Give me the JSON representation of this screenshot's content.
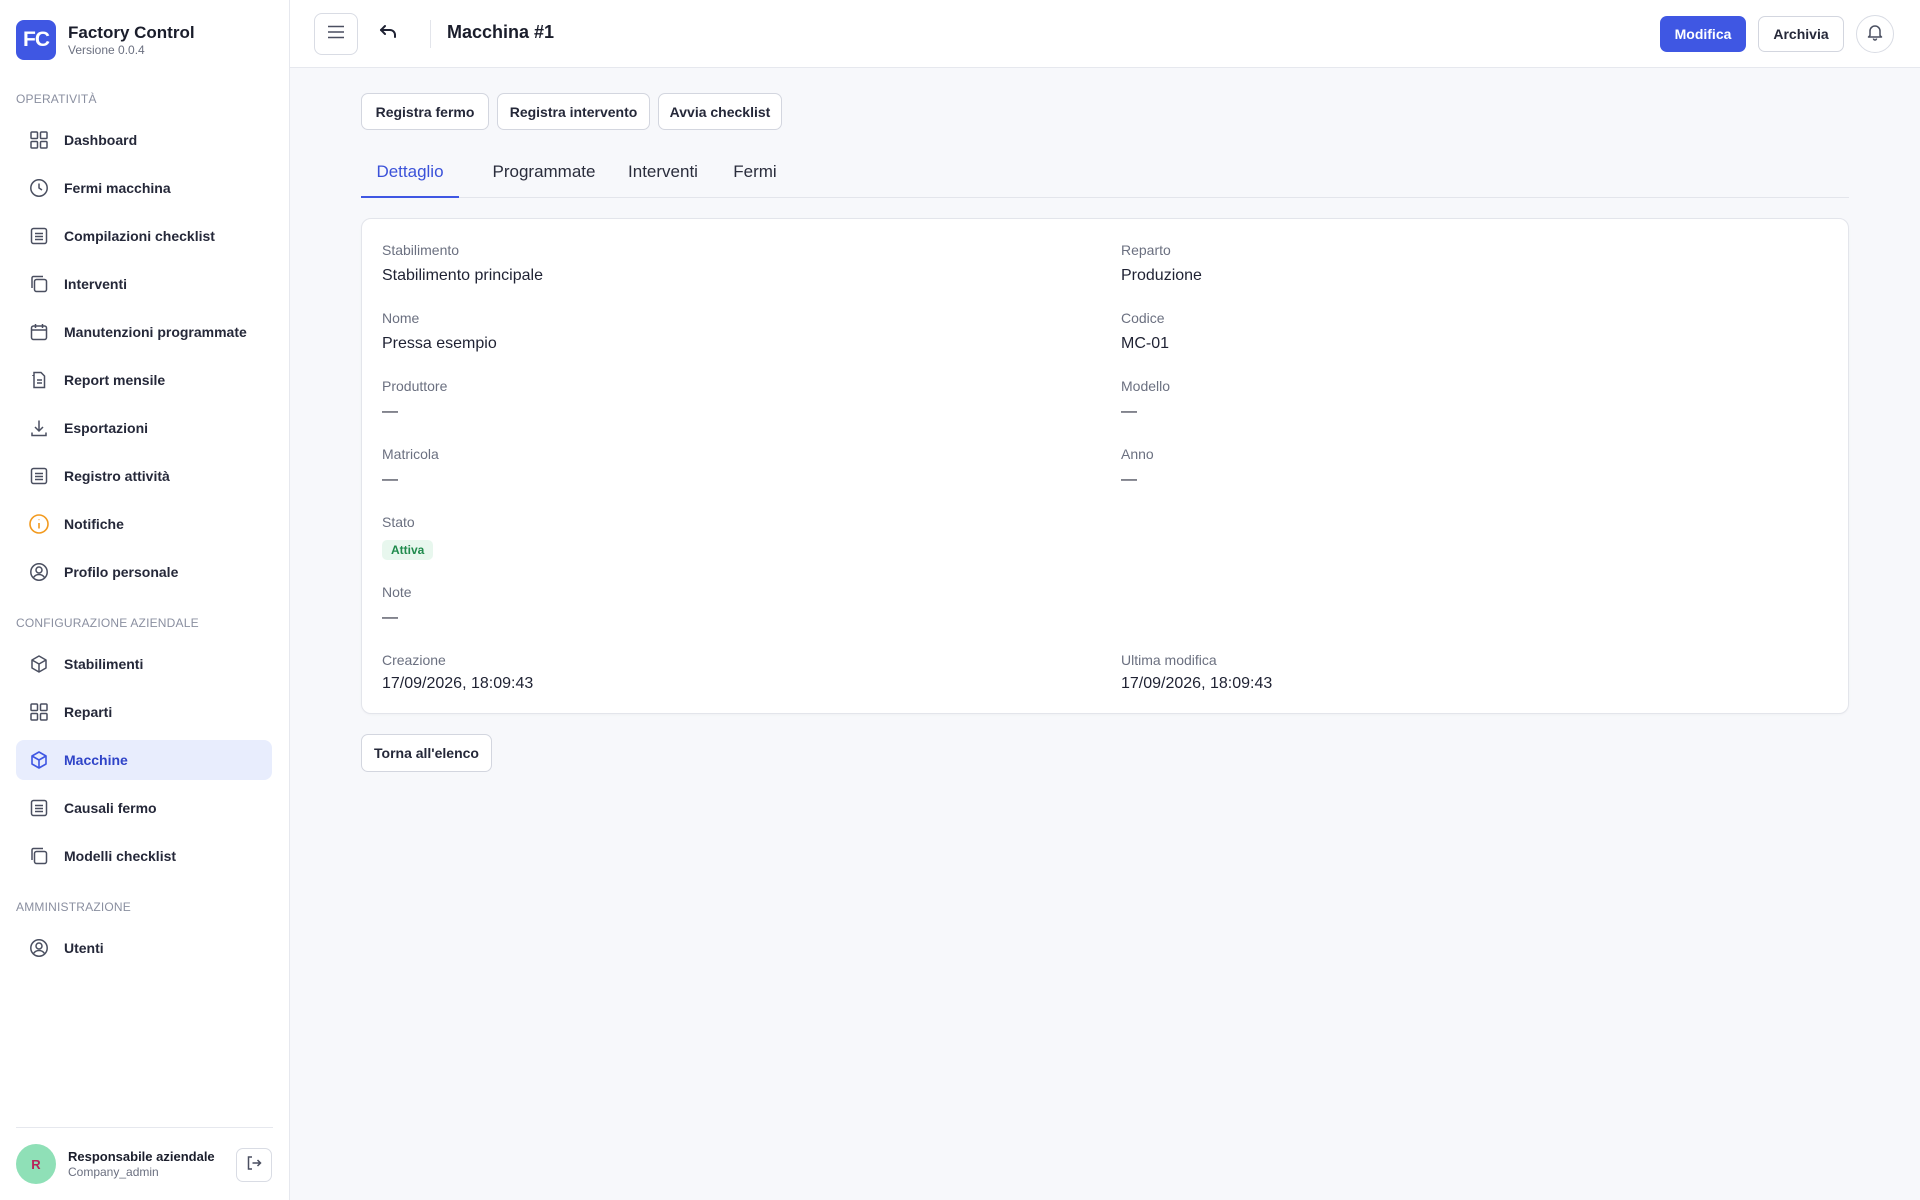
{
  "app": {
    "logo_text": "FC",
    "name": "Factory Control",
    "version": "Versione 0.0.4"
  },
  "colors": {
    "accent": "#3f57e3",
    "active_bg": "#e8edfd",
    "success": "#1f8a4c",
    "warning": "#f29a1f"
  },
  "sidebar": {
    "sections": [
      {
        "label": "OPERATIVITÀ"
      },
      {
        "label": "CONFIGURAZIONE AZIENDALE"
      },
      {
        "label": "AMMINISTRAZIONE"
      }
    ],
    "items": [
      {
        "label": "Dashboard",
        "icon": "grid-icon"
      },
      {
        "label": "Fermi macchina",
        "icon": "clock-icon"
      },
      {
        "label": "Compilazioni checklist",
        "icon": "list-icon"
      },
      {
        "label": "Interventi",
        "icon": "copy-icon"
      },
      {
        "label": "Manutenzioni programmate",
        "icon": "calendar-icon"
      },
      {
        "label": "Report mensile",
        "icon": "document-icon"
      },
      {
        "label": "Esportazioni",
        "icon": "download-icon"
      },
      {
        "label": "Registro attività",
        "icon": "list-icon"
      },
      {
        "label": "Notifiche",
        "icon": "info-icon"
      },
      {
        "label": "Profilo personale",
        "icon": "user-circle-icon"
      },
      {
        "label": "Stabilimenti",
        "icon": "cube-icon"
      },
      {
        "label": "Reparti",
        "icon": "grid-icon"
      },
      {
        "label": "Macchine",
        "icon": "cube-icon",
        "active": true
      },
      {
        "label": "Causali fermo",
        "icon": "list-icon"
      },
      {
        "label": "Modelli checklist",
        "icon": "copy-icon"
      },
      {
        "label": "Utenti",
        "icon": "user-circle-icon"
      }
    ]
  },
  "user": {
    "initial": "R",
    "name": "Responsabile aziendale",
    "role": "Company_admin"
  },
  "header": {
    "title": "Macchina #1",
    "edit_label": "Modifica",
    "archive_label": "Archivia"
  },
  "actions": [
    "Registra fermo",
    "Registra intervento",
    "Avvia checklist"
  ],
  "tabs": [
    {
      "label": "Dettaglio",
      "active": true
    },
    {
      "label": "Programmate"
    },
    {
      "label": "Interventi"
    },
    {
      "label": "Fermi"
    }
  ],
  "details": {
    "stabilimento": {
      "label": "Stabilimento",
      "value": "Stabilimento principale"
    },
    "reparto": {
      "label": "Reparto",
      "value": "Produzione"
    },
    "nome": {
      "label": "Nome",
      "value": "Pressa esempio"
    },
    "codice": {
      "label": "Codice",
      "value": "MC-01"
    },
    "produttore": {
      "label": "Produttore",
      "value": "—"
    },
    "modello": {
      "label": "Modello",
      "value": "—"
    },
    "matricola": {
      "label": "Matricola",
      "value": "—"
    },
    "anno": {
      "label": "Anno",
      "value": "—"
    },
    "stato": {
      "label": "Stato",
      "value": "Attiva"
    },
    "note": {
      "label": "Note",
      "value": "—"
    },
    "creazione": {
      "label": "Creazione",
      "value": "17/09/2026, 18:09:43"
    },
    "ultima_modifica": {
      "label": "Ultima modifica",
      "value": "17/09/2026, 18:09:43"
    }
  },
  "back_label": "Torna all'elenco"
}
